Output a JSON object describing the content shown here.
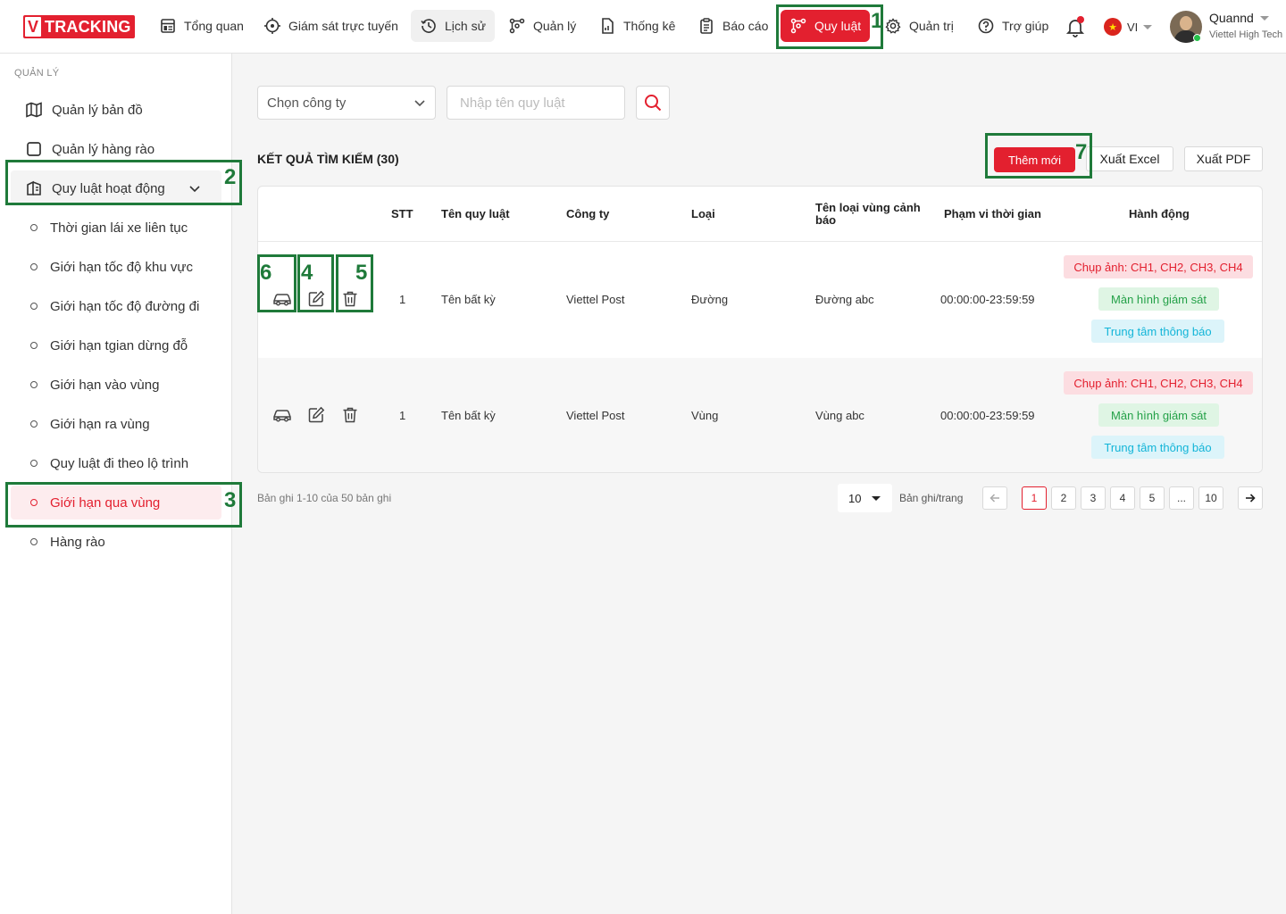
{
  "header": {
    "logo_v": "V",
    "logo_text": "TRACKING",
    "nav": [
      {
        "label": "Tổng quan",
        "icon": "dashboard-icon"
      },
      {
        "label": "Giám sát trực tuyến",
        "icon": "crosshair-icon"
      },
      {
        "label": "Lịch sử",
        "icon": "history-icon"
      },
      {
        "label": "Quản lý",
        "icon": "route-icon"
      },
      {
        "label": "Thống kê",
        "icon": "file-chart-icon"
      },
      {
        "label": "Báo cáo",
        "icon": "clipboard-icon"
      },
      {
        "label": "Quy luật",
        "icon": "rules-icon"
      },
      {
        "label": "Quản trị",
        "icon": "gear-icon"
      },
      {
        "label": "Trợ giúp",
        "icon": "help-icon"
      }
    ],
    "active_nav": "Quy luật",
    "language": "VI",
    "user_name": "Quannd",
    "user_company": "Viettel High Tech"
  },
  "annotations": [
    "1",
    "2",
    "3",
    "4",
    "5",
    "6",
    "7"
  ],
  "sidebar": {
    "section": "QUẢN LÝ",
    "items": [
      {
        "label": "Quản lý bản đồ",
        "icon": "map-icon"
      },
      {
        "label": "Quản lý hàng rào",
        "icon": "square-icon"
      },
      {
        "label": "Quy luật hoạt động",
        "icon": "rules-book-icon"
      }
    ],
    "sub_items": [
      "Thời gian lái xe liên tục",
      "Giới hạn tốc độ khu vực",
      "Giới hạn tốc độ đường đi",
      "Giới hạn tgian dừng đỗ",
      "Giới hạn vào vùng",
      "Giới hạn ra vùng",
      "Quy luật đi theo lộ trình",
      "Giới hạn qua vùng",
      "Hàng rào"
    ],
    "active_sub": "Giới hạn qua vùng"
  },
  "filters": {
    "company_placeholder": "Chọn công ty",
    "rule_placeholder": "Nhập tên quy luật"
  },
  "results": {
    "title": "KẾT QUẢ TÌM KIẾM (30)",
    "add_button": "Thêm mới",
    "excel_button": "Xuất Excel",
    "pdf_button": "Xuất PDF"
  },
  "table": {
    "columns": [
      "STT",
      "Tên quy luật",
      "Công ty",
      "Loại",
      "Tên loại vùng cảnh báo",
      "Phạm vi thời gian",
      "Hành động"
    ],
    "rows": [
      {
        "stt": "1",
        "name": "Tên bất kỳ",
        "company": "Viettel Post",
        "type": "Đường",
        "zone": "Đường abc",
        "time": "00:00:00-23:59:59",
        "actions": [
          "Chụp ảnh: CH1, CH2, CH3, CH4",
          "Màn hình giám sát",
          "Trung tâm thông báo"
        ]
      },
      {
        "stt": "1",
        "name": "Tên bất kỳ",
        "company": "Viettel Post",
        "type": "Vùng",
        "zone": "Vùng abc",
        "time": "00:00:00-23:59:59",
        "actions": [
          "Chụp ảnh: CH1, CH2, CH3, CH4",
          "Màn hình giám sát",
          "Trung tâm thông báo"
        ]
      }
    ]
  },
  "pagination": {
    "info": "Bản ghi 1-10 của 50 bản ghi",
    "page_size": "10",
    "page_size_label": "Bản ghi/trang",
    "pages": [
      "1",
      "2",
      "3",
      "4",
      "5",
      "...",
      "10"
    ],
    "current": "1"
  },
  "colors": {
    "brand": "#e3202f",
    "annotation": "#1f7a3a",
    "tag_green": "#24a148",
    "tag_cyan": "#13b5d8"
  }
}
